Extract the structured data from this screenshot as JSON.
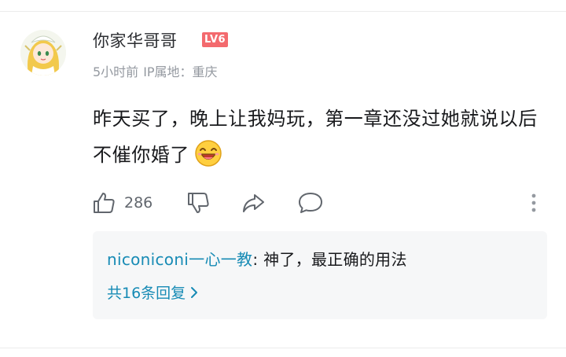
{
  "comment": {
    "username": "你家华哥哥",
    "level_badge": "LV6",
    "time": "5小时前",
    "ip_location": "IP属地：重庆",
    "text": "昨天买了，晚上让我妈玩，第一章还没过她就说以后不催你婚了",
    "emoji_icon": "laughing-face-icon",
    "like_count": "286"
  },
  "reply": {
    "username": "niconiconi一心一教",
    "separator": ": ",
    "text": "神了，最正确的用法",
    "more_replies": "共16条回复"
  },
  "colors": {
    "link": "#178bb5",
    "meta": "#9499a0",
    "badge": "#f36a6e",
    "reply_bg": "#f6f7f8"
  }
}
